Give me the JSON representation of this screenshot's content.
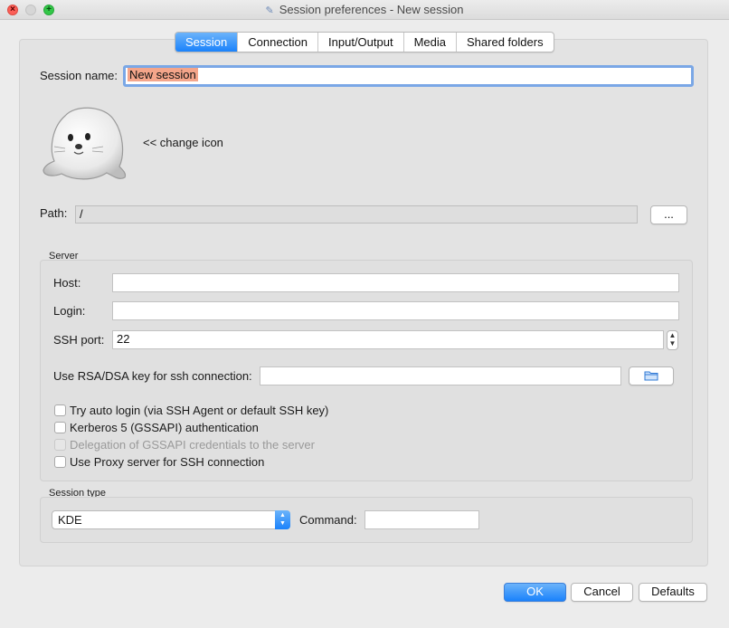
{
  "window": {
    "title": "Session preferences - New session"
  },
  "tabs": [
    {
      "label": "Session",
      "active": true
    },
    {
      "label": "Connection",
      "active": false
    },
    {
      "label": "Input/Output",
      "active": false
    },
    {
      "label": "Media",
      "active": false
    },
    {
      "label": "Shared folders",
      "active": false
    }
  ],
  "session": {
    "name_label": "Session name:",
    "name_value": "New session",
    "change_icon_label": "<< change icon",
    "path_label": "Path:",
    "path_value": "/",
    "browse_label": "..."
  },
  "server": {
    "group_label": "Server",
    "host_label": "Host:",
    "host_value": "",
    "login_label": "Login:",
    "login_value": "",
    "port_label": "SSH port:",
    "port_value": "22",
    "key_label": "Use RSA/DSA key for ssh connection:",
    "key_value": "",
    "checkboxes": [
      {
        "label": "Try auto login (via SSH Agent or default SSH key)",
        "checked": false,
        "enabled": true
      },
      {
        "label": "Kerberos 5 (GSSAPI) authentication",
        "checked": false,
        "enabled": true
      },
      {
        "label": "Delegation of GSSAPI credentials to the server",
        "checked": false,
        "enabled": false
      },
      {
        "label": "Use Proxy server for SSH connection",
        "checked": false,
        "enabled": true
      }
    ]
  },
  "session_type": {
    "group_label": "Session type",
    "selected": "KDE",
    "command_label": "Command:",
    "command_value": ""
  },
  "footer": {
    "ok": "OK",
    "cancel": "Cancel",
    "defaults": "Defaults"
  },
  "colors": {
    "accent": "#1a82fb",
    "selection": "#f4a58a",
    "focus_ring": "#7aa7e6"
  }
}
